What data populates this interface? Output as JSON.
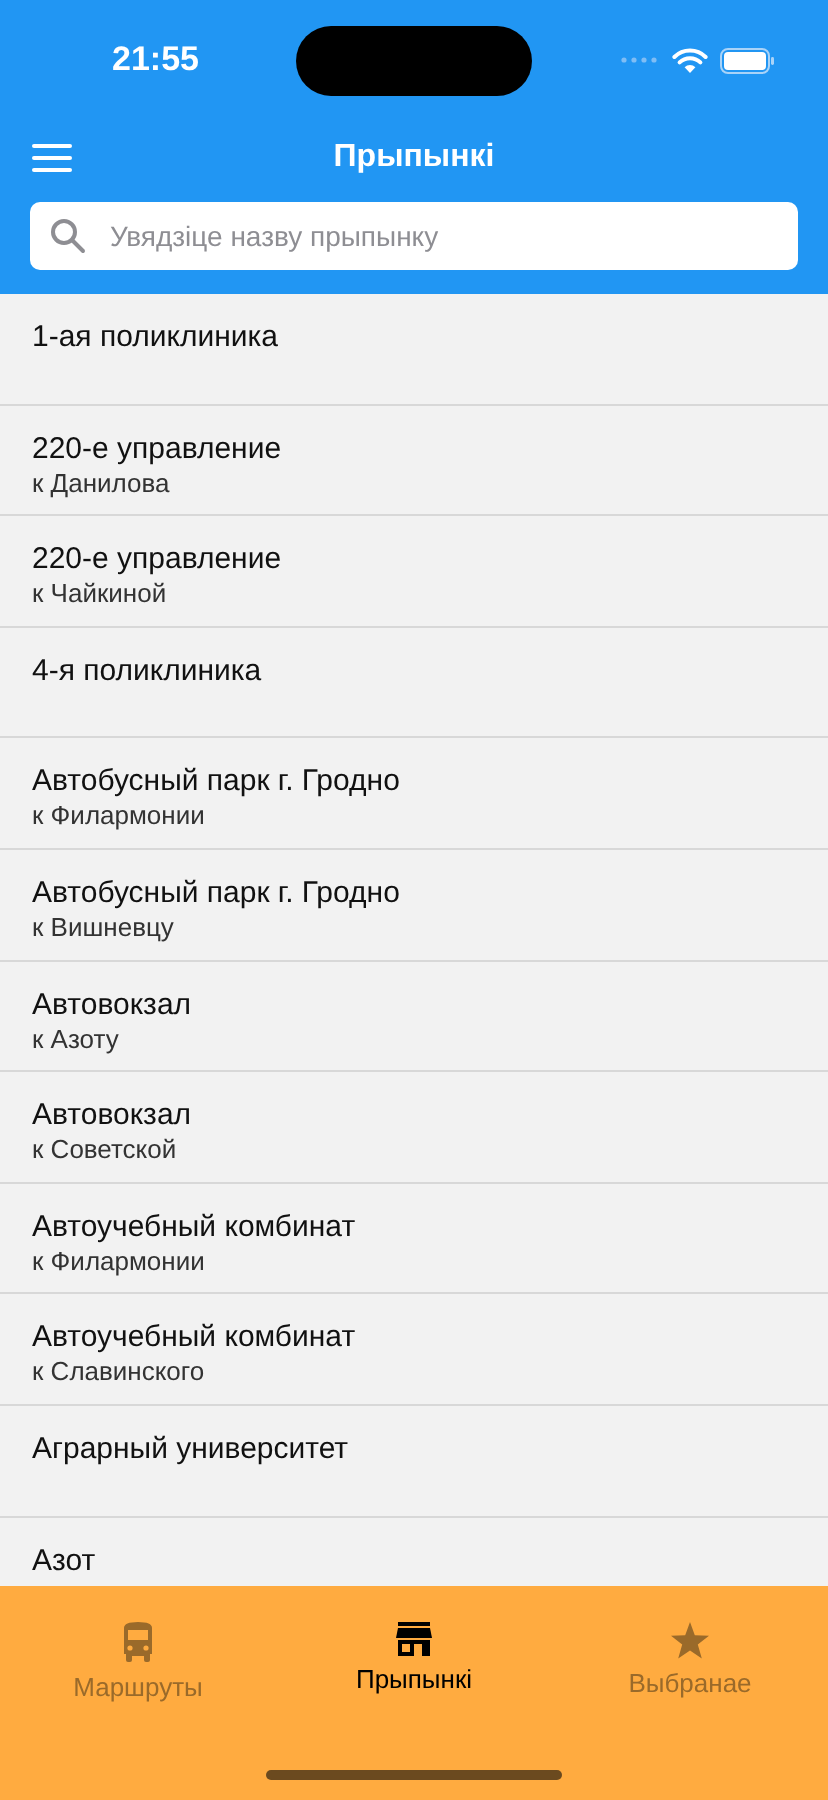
{
  "status_bar": {
    "time": "21:55"
  },
  "header": {
    "title": "Прыпынкі"
  },
  "search": {
    "placeholder": "Увядзіце назву прыпынку"
  },
  "stops": [
    {
      "name": "1-ая поликлиника"
    },
    {
      "name": "220-е управление",
      "direction": "к Данилова"
    },
    {
      "name": "220-е управление",
      "direction": "к Чайкиной"
    },
    {
      "name": "4-я поликлиника"
    },
    {
      "name": "Автобусный парк г. Гродно",
      "direction": "к Филармонии"
    },
    {
      "name": "Автобусный парк г. Гродно",
      "direction": "к Вишневцу"
    },
    {
      "name": "Автовокзал",
      "direction": "к Азоту"
    },
    {
      "name": "Автовокзал",
      "direction": "к Советской"
    },
    {
      "name": "Автоучебный комбинат",
      "direction": "к Филармонии"
    },
    {
      "name": "Автоучебный комбинат",
      "direction": "к Славинского"
    },
    {
      "name": "Аграрный университет"
    },
    {
      "name": "Азот"
    }
  ],
  "tabs": [
    {
      "label": "Маршруты",
      "kind": "bus",
      "selected": false
    },
    {
      "label": "Прыпынкі",
      "kind": "stop",
      "selected": true
    },
    {
      "label": "Выбранае",
      "kind": "star",
      "selected": false
    }
  ]
}
